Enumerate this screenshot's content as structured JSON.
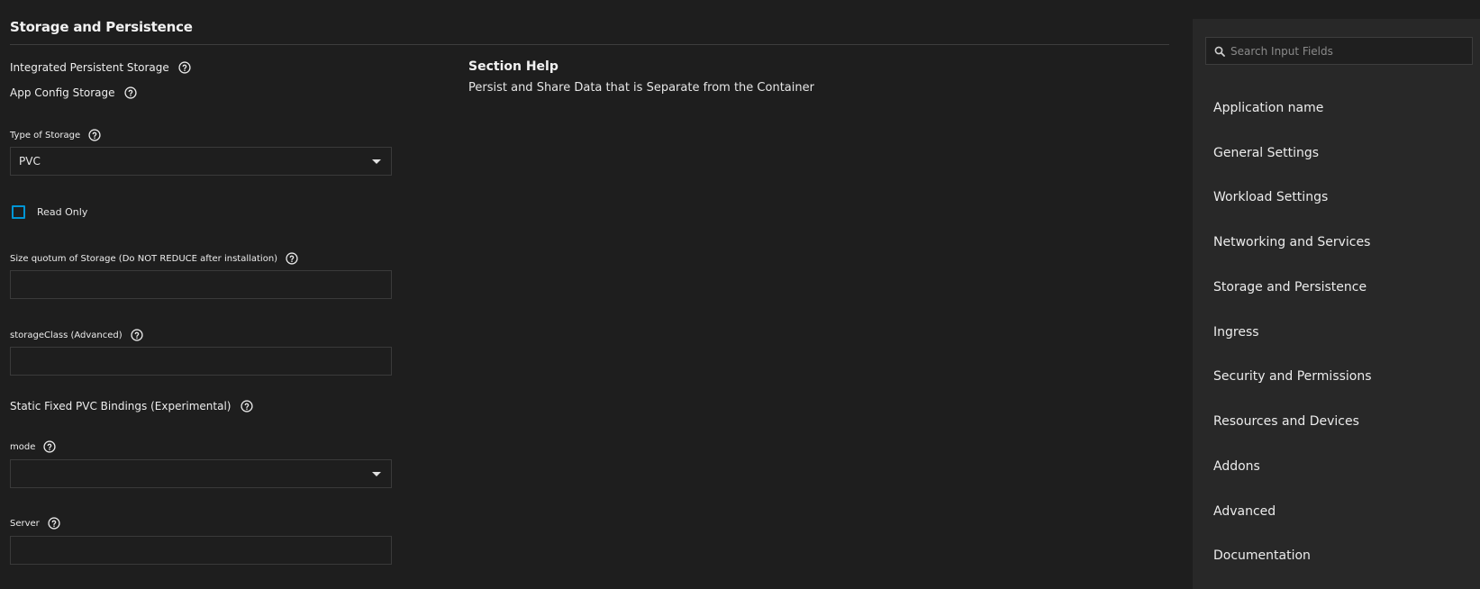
{
  "section": {
    "title": "Storage and Persistence"
  },
  "form": {
    "integrated_persistent_storage_label": "Integrated Persistent Storage",
    "app_config_storage_label": "App Config Storage",
    "type_of_storage": {
      "label": "Type of Storage",
      "value": "PVC"
    },
    "read_only": {
      "label": "Read Only",
      "checked": false
    },
    "size_quotum": {
      "label": "Size quotum of Storage (Do NOT REDUCE after installation)",
      "value": ""
    },
    "storage_class": {
      "label": "storageClass (Advanced)",
      "value": ""
    },
    "static_fixed_pvc_label": "Static Fixed PVC Bindings (Experimental)",
    "mode": {
      "label": "mode",
      "value": ""
    },
    "server": {
      "label": "Server",
      "value": ""
    }
  },
  "section_help": {
    "heading": "Section Help",
    "text": "Persist and Share Data that is Separate from the Container"
  },
  "sidebar": {
    "search_placeholder": "Search Input Fields",
    "items": [
      {
        "label": "Application name"
      },
      {
        "label": "General Settings"
      },
      {
        "label": "Workload Settings"
      },
      {
        "label": "Networking and Services"
      },
      {
        "label": "Storage and Persistence"
      },
      {
        "label": "Ingress"
      },
      {
        "label": "Security and Permissions"
      },
      {
        "label": "Resources and Devices"
      },
      {
        "label": "Addons"
      },
      {
        "label": "Advanced"
      },
      {
        "label": "Documentation"
      }
    ]
  },
  "colors": {
    "background": "#1e1e1e",
    "sidebar_background": "#282828",
    "checkbox_accent": "#0095d5"
  }
}
